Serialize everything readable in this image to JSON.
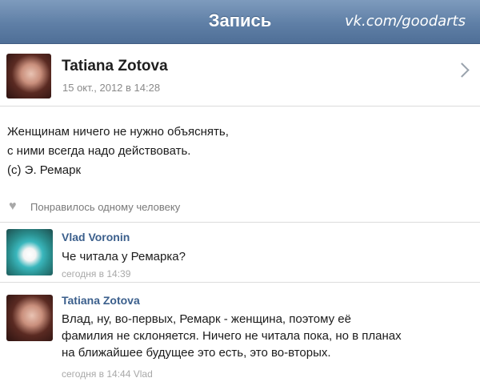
{
  "navbar": {
    "title": "Запись",
    "watermark": "vk.com/goodarts"
  },
  "post": {
    "author": "Tatiana Zotova",
    "date": "15 окт., 2012 в 14:28",
    "text_lines": [
      "Женщинам ничего не нужно объяснять,",
      "с ними всегда надо действовать.",
      "(с) Э. Ремарк"
    ],
    "likes": "Понравилось одному человеку"
  },
  "comments": [
    {
      "author": "Vlad Voronin",
      "text_lines": [
        "Че читала у Ремарка?"
      ],
      "meta": "сегодня в 14:39"
    },
    {
      "author": "Tatiana Zotova",
      "text_lines": [
        "Влад, ну, во-первых, Ремарк - женщина, поэтому её",
        "фамилия не склоняется. Ничего не читала пока, но в планах",
        "на ближайшее будущее это есть, это во-вторых."
      ],
      "meta": "сегодня в 14:44 Vlad"
    }
  ],
  "colors": {
    "navbar": "#5f7fa6",
    "comment_author": "#3b5f8c"
  },
  "icons": [
    "chevron-right-icon",
    "heart-icon"
  ]
}
